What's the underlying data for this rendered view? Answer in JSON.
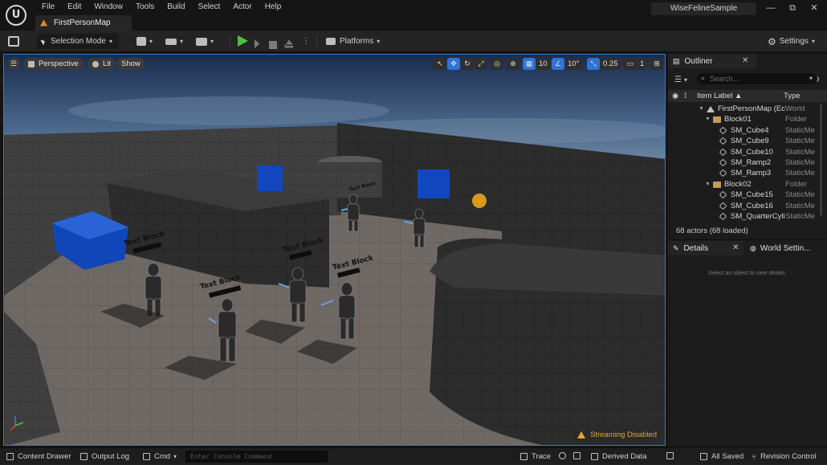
{
  "app": {
    "project_name": "WiseFelineSample",
    "map_tab": "FirstPersonMap",
    "menu": [
      "File",
      "Edit",
      "Window",
      "Tools",
      "Build",
      "Select",
      "Actor",
      "Help"
    ],
    "window_controls": [
      "—",
      "⧉",
      "✕"
    ]
  },
  "toolbar": {
    "selection_mode": "Selection Mode",
    "platforms": "Platforms",
    "settings": "Settings"
  },
  "viewport": {
    "perspective": "Perspective",
    "lit": "Lit",
    "show": "Show",
    "grid_snap": "10",
    "rotation_snap": "10°",
    "scale_snap": "0.25",
    "camera_speed": "1",
    "streaming": "Streaming Disabled",
    "block_label": "Text Block"
  },
  "outliner": {
    "title": "Outliner",
    "search_placeholder": "Search...",
    "col_label": "Item Label ▲",
    "col_type": "Type",
    "rows": [
      {
        "label": "FirstPersonMap (Ec",
        "type": "World",
        "depth": 0,
        "icon": "world-icon"
      },
      {
        "label": "Block01",
        "type": "Folder",
        "depth": 1,
        "icon": "folder-icon"
      },
      {
        "label": "SM_Cube4",
        "type": "StaticMe",
        "depth": 2,
        "icon": "mesh-icon"
      },
      {
        "label": "SM_Cube9",
        "type": "StaticMe",
        "depth": 2,
        "icon": "mesh-icon"
      },
      {
        "label": "SM_Cube10",
        "type": "StaticMe",
        "depth": 2,
        "icon": "mesh-icon"
      },
      {
        "label": "SM_Ramp2",
        "type": "StaticMe",
        "depth": 2,
        "icon": "mesh-icon"
      },
      {
        "label": "SM_Ramp3",
        "type": "StaticMe",
        "depth": 2,
        "icon": "mesh-icon"
      },
      {
        "label": "Block02",
        "type": "Folder",
        "depth": 1,
        "icon": "folder-icon"
      },
      {
        "label": "SM_Cube15",
        "type": "StaticMe",
        "depth": 2,
        "icon": "mesh-icon"
      },
      {
        "label": "SM_Cube16",
        "type": "StaticMe",
        "depth": 2,
        "icon": "mesh-icon"
      },
      {
        "label": "SM_QuarterCyli",
        "type": "StaticMe",
        "depth": 2,
        "icon": "mesh-icon"
      }
    ],
    "actor_count": "68 actors (68 loaded)"
  },
  "details": {
    "title": "Details",
    "world_settings": "World Settin...",
    "empty_message": "Select an object to view details."
  },
  "bottombar": {
    "content_drawer": "Content Drawer",
    "output_log": "Output Log",
    "cmd": "Cmd",
    "console_placeholder": "Enter Console Command",
    "trace": "Trace",
    "derived_data": "Derived Data",
    "all_saved": "All Saved",
    "revision_control": "Revision Control"
  }
}
